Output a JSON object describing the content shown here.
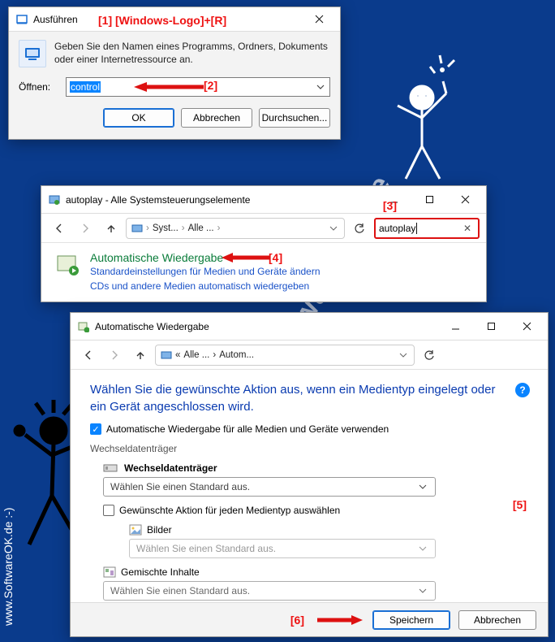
{
  "run": {
    "title": "Ausführen",
    "description": "Geben Sie den Namen eines Programms, Ordners, Dokuments oder einer Internetressource an.",
    "open_label": "Öffnen:",
    "input_value": "control",
    "ok": "OK",
    "cancel": "Abbrechen",
    "browse": "Durchsuchen..."
  },
  "cp": {
    "title": "autoplay - Alle Systemsteuerungselemente",
    "crumb1": "Syst...",
    "crumb2": "Alle ...",
    "search_value": "autoplay",
    "result_heading": "Automatische Wiedergabe",
    "result_line1": "Standardeinstellungen für Medien und Geräte ändern",
    "result_line2": "CDs und andere Medien automatisch wiedergeben"
  },
  "ap": {
    "title": "Automatische Wiedergabe",
    "crumb1": "Alle ...",
    "crumb2": "Autom...",
    "heading": "Wählen Sie die gewünschte Aktion aus, wenn ein Medientyp eingelegt oder ein Gerät angeschlossen wird.",
    "chk_all": "Automatische Wiedergabe für alle Medien und Geräte verwenden",
    "section": "Wechseldatenträger",
    "device": "Wechseldatenträger",
    "select_placeholder": "Wählen Sie einen Standard aus.",
    "chk_each": "Gewünschte Aktion für jeden Medientyp auswählen",
    "item_pictures": "Bilder",
    "item_mixed": "Gemischte Inhalte",
    "save": "Speichern",
    "cancel": "Abbrechen"
  },
  "markers": {
    "m1": "[1] [Windows-Logo]+[R]",
    "m2": "[2]",
    "m3": "[3]",
    "m4": "[4]",
    "m5": "[5]",
    "m6": "[6]"
  },
  "watermark": "SoftwareOK.de",
  "sidetext": "www.SoftwareOK.de  :-)"
}
